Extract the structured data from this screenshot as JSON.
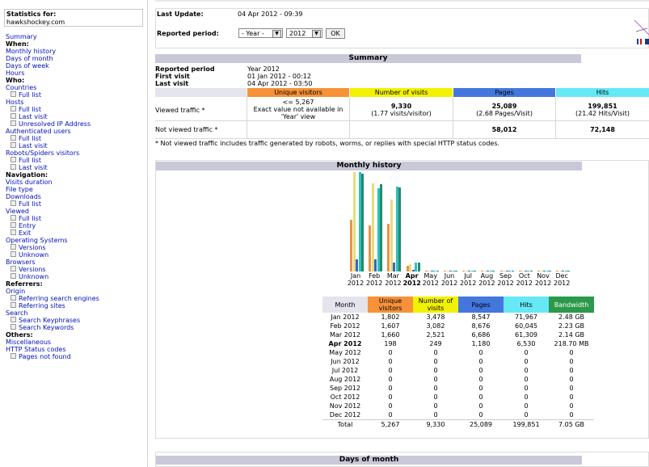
{
  "sidebar": {
    "stats_label": "Statistics for:",
    "site": "hawkshockey.com",
    "nav": [
      {
        "text": "Summary",
        "type": "link"
      },
      {
        "text": "When:",
        "type": "head"
      },
      {
        "text": "Monthly history",
        "type": "link"
      },
      {
        "text": "Days of month",
        "type": "link"
      },
      {
        "text": "Days of week",
        "type": "link"
      },
      {
        "text": "Hours",
        "type": "link"
      },
      {
        "text": "Who:",
        "type": "head"
      },
      {
        "text": "Countries",
        "type": "link"
      },
      {
        "text": "Full list",
        "type": "sub"
      },
      {
        "text": "Hosts",
        "type": "link"
      },
      {
        "text": "Full list",
        "type": "sub"
      },
      {
        "text": "Last visit",
        "type": "sub"
      },
      {
        "text": "Unresolved IP Address",
        "type": "sub"
      },
      {
        "text": "Authenticated users",
        "type": "link"
      },
      {
        "text": "Full list",
        "type": "sub"
      },
      {
        "text": "Last visit",
        "type": "sub"
      },
      {
        "text": "Robots/Spiders visitors",
        "type": "link"
      },
      {
        "text": "Full list",
        "type": "sub"
      },
      {
        "text": "Last visit",
        "type": "sub"
      },
      {
        "text": "Navigation:",
        "type": "head"
      },
      {
        "text": "Visits duration",
        "type": "link"
      },
      {
        "text": "File type",
        "type": "link"
      },
      {
        "text": "Downloads",
        "type": "link"
      },
      {
        "text": "Full list",
        "type": "sub"
      },
      {
        "text": "Viewed",
        "type": "link"
      },
      {
        "text": "Full list",
        "type": "sub"
      },
      {
        "text": "Entry",
        "type": "sub"
      },
      {
        "text": "Exit",
        "type": "sub"
      },
      {
        "text": "Operating Systems",
        "type": "link"
      },
      {
        "text": "Versions",
        "type": "sub"
      },
      {
        "text": "Unknown",
        "type": "sub"
      },
      {
        "text": "Browsers",
        "type": "link"
      },
      {
        "text": "Versions",
        "type": "sub"
      },
      {
        "text": "Unknown",
        "type": "sub"
      },
      {
        "text": "Referrers:",
        "type": "head"
      },
      {
        "text": "Origin",
        "type": "link"
      },
      {
        "text": "Referring search engines",
        "type": "sub"
      },
      {
        "text": "Referring sites",
        "type": "sub"
      },
      {
        "text": "Search",
        "type": "link"
      },
      {
        "text": "Search Keyphrases",
        "type": "sub"
      },
      {
        "text": "Search Keywords",
        "type": "sub"
      },
      {
        "text": "Others:",
        "type": "head"
      },
      {
        "text": "Miscellaneous",
        "type": "link"
      },
      {
        "text": "HTTP Status codes",
        "type": "link"
      },
      {
        "text": "Pages not found",
        "type": "sub"
      }
    ]
  },
  "info": {
    "last_update_label": "Last Update:",
    "last_update_value": "04 Apr 2012 - 09:39",
    "period_label": "Reported period:",
    "period_select": "- Year -",
    "year_select": "2012",
    "ok_label": "OK"
  },
  "summary": {
    "title": "Summary",
    "reported_period_label": "Reported period",
    "reported_period_value": "Year 2012",
    "first_visit_label": "First visit",
    "first_visit_value": "01 Jan 2012 - 00:12",
    "last_visit_label": "Last visit",
    "last_visit_value": "04 Apr 2012 - 03:50",
    "headers": [
      "Unique visitors",
      "Number of visits",
      "Pages",
      "Hits"
    ],
    "viewed_label": "Viewed traffic *",
    "viewed": {
      "unique": "<= 5,267",
      "unique_note1": "Exact value not available in",
      "unique_note2": "'Year' view",
      "visits": "9,330",
      "visits_sub": "(1.77 visits/visitor)",
      "pages": "25,089",
      "pages_sub": "(2.68 Pages/Visit)",
      "hits": "199,851",
      "hits_sub": "(21.42 Hits/Visit)"
    },
    "not_viewed_label": "Not viewed traffic *",
    "not_viewed": {
      "pages": "58,012",
      "hits": "72,148"
    },
    "footnote": "* Not viewed traffic includes traffic generated by robots, worms, or replies with special HTTP status codes."
  },
  "monthly": {
    "title": "Monthly history",
    "months": [
      "Jan",
      "Feb",
      "Mar",
      "Apr",
      "May",
      "Jun",
      "Jul",
      "Aug",
      "Sep",
      "Oct",
      "Nov",
      "Dec"
    ],
    "year": "2012",
    "current_index": 3,
    "headers": [
      "Month",
      "Unique visitors",
      "Number of visits",
      "Pages",
      "Hits",
      "Bandwidth"
    ],
    "rows": [
      [
        "Jan 2012",
        "1,802",
        "3,478",
        "8,547",
        "71,967",
        "2.48 GB"
      ],
      [
        "Feb 2012",
        "1,607",
        "3,082",
        "8,676",
        "60,045",
        "2.23 GB"
      ],
      [
        "Mar 2012",
        "1,660",
        "2,521",
        "6,686",
        "61,309",
        "2.14 GB"
      ],
      [
        "Apr 2012",
        "198",
        "249",
        "1,180",
        "6,530",
        "218.70 MB"
      ],
      [
        "May 2012",
        "0",
        "0",
        "0",
        "0",
        "0"
      ],
      [
        "Jun 2012",
        "0",
        "0",
        "0",
        "0",
        "0"
      ],
      [
        "Jul 2012",
        "0",
        "0",
        "0",
        "0",
        "0"
      ],
      [
        "Aug 2012",
        "0",
        "0",
        "0",
        "0",
        "0"
      ],
      [
        "Sep 2012",
        "0",
        "0",
        "0",
        "0",
        "0"
      ],
      [
        "Oct 2012",
        "0",
        "0",
        "0",
        "0",
        "0"
      ],
      [
        "Nov 2012",
        "0",
        "0",
        "0",
        "0",
        "0"
      ],
      [
        "Dec 2012",
        "0",
        "0",
        "0",
        "0",
        "0"
      ]
    ],
    "total": [
      "Total",
      "5,267",
      "9,330",
      "25,089",
      "199,851",
      "7.05 GB"
    ]
  },
  "chart_data": {
    "type": "bar",
    "categories": [
      "Jan 2012",
      "Feb 2012",
      "Mar 2012",
      "Apr 2012",
      "May 2012",
      "Jun 2012",
      "Jul 2012",
      "Aug 2012",
      "Sep 2012",
      "Oct 2012",
      "Nov 2012",
      "Dec 2012"
    ],
    "series": [
      {
        "name": "Unique visitors",
        "values": [
          1802,
          1607,
          1660,
          198,
          0,
          0,
          0,
          0,
          0,
          0,
          0,
          0
        ]
      },
      {
        "name": "Number of visits",
        "values": [
          3478,
          3082,
          2521,
          249,
          0,
          0,
          0,
          0,
          0,
          0,
          0,
          0
        ]
      },
      {
        "name": "Pages",
        "values": [
          8547,
          8676,
          6686,
          1180,
          0,
          0,
          0,
          0,
          0,
          0,
          0,
          0
        ]
      },
      {
        "name": "Hits",
        "values": [
          71967,
          60045,
          61309,
          6530,
          0,
          0,
          0,
          0,
          0,
          0,
          0,
          0
        ]
      },
      {
        "name": "Bandwidth",
        "values": [
          2.48,
          2.23,
          2.14,
          0.2187,
          0,
          0,
          0,
          0,
          0,
          0,
          0,
          0
        ]
      }
    ],
    "title": "Monthly history",
    "xlabel": "",
    "ylabel": ""
  },
  "days": {
    "title": "Days of month"
  },
  "colors": {
    "unique": "#f7923a",
    "visits": "#f2f200",
    "pages": "#4477dd",
    "hits": "#66e8f5",
    "bandwidth": "#2a9a4a",
    "unique_bar": "#e89446",
    "visits_bar": "#e8dc7a",
    "pages_bar": "#3366cc",
    "hits_bar": "#2ebfbf",
    "bandwidth_bar": "#1f8c6a"
  }
}
